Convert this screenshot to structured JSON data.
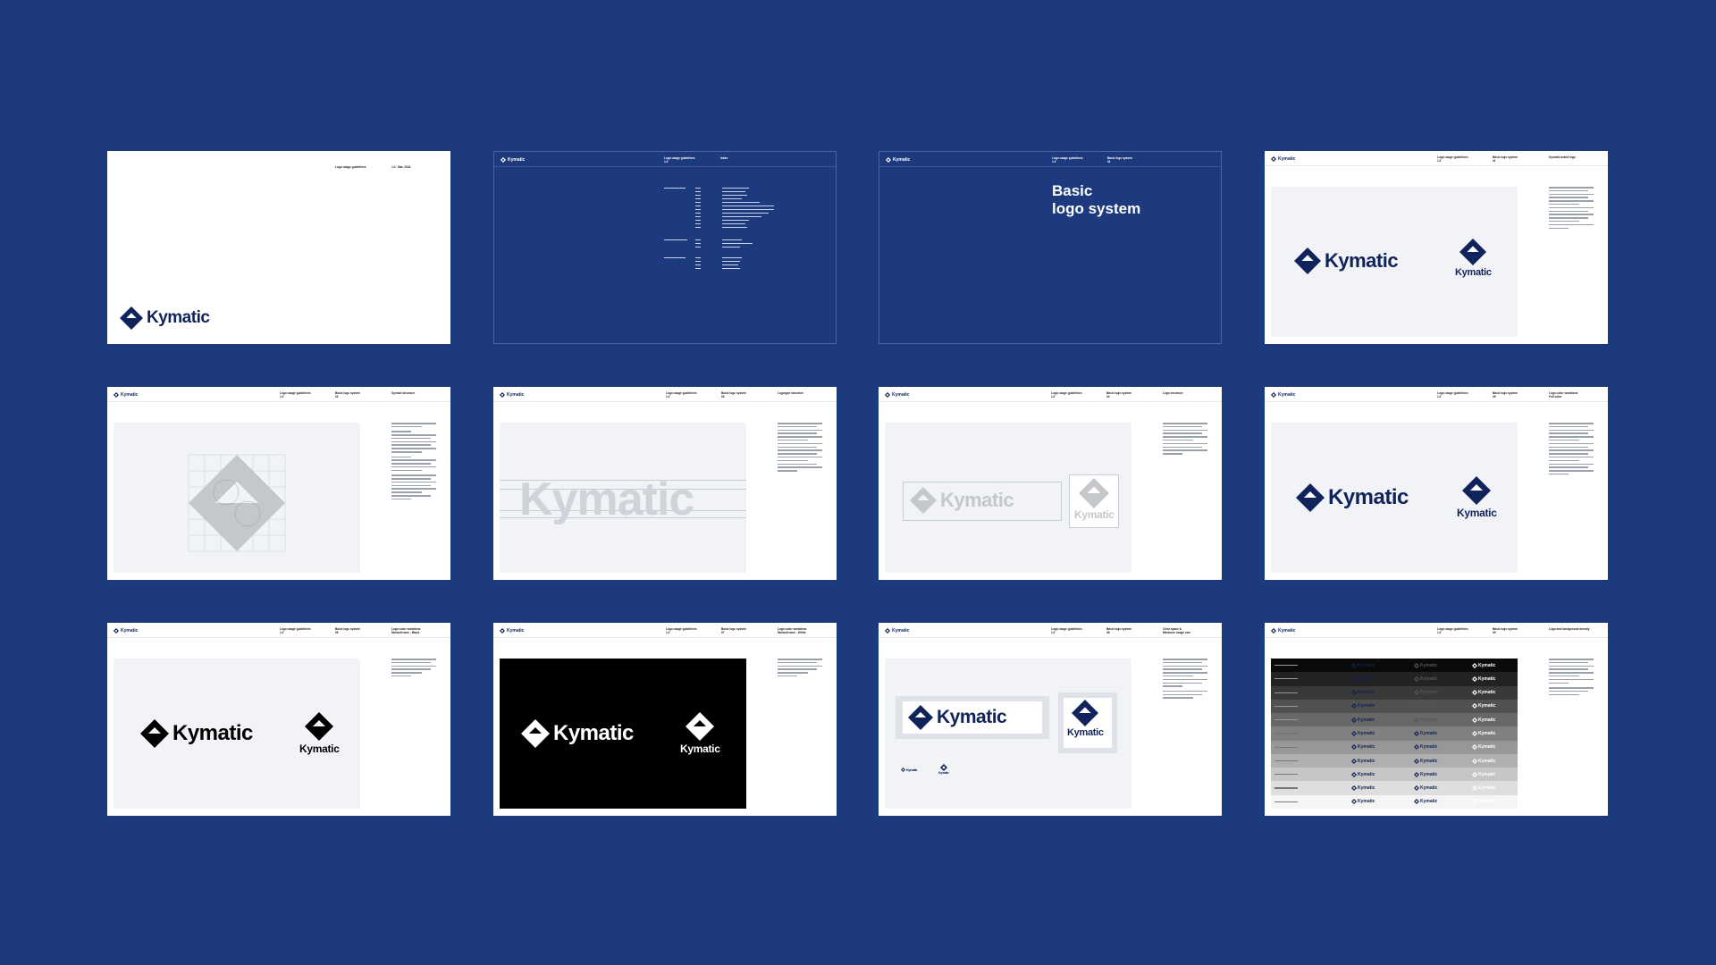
{
  "brand": {
    "name": "Kymatic",
    "navy": "#10235a",
    "blue": "#1c3a7d",
    "background": "#1c3a7d"
  },
  "cover": {
    "title": "Logo usage guidelines",
    "version": "1.0 , Mar. 2024"
  },
  "index": {
    "col1": "Logo usage guidelines\n1.0",
    "col2": "Index"
  },
  "section": {
    "col1": "Logo usage guidelines\n1.0",
    "col2": "Basic logo system\n01",
    "title_line1": "Basic",
    "title_line2": "logo system"
  },
  "slides": {
    "s4": {
      "c1": "Logo usage guidelines\n1.0",
      "c2": "Basic logo system\n01",
      "c3": "Kymatic brand logo"
    },
    "s5": {
      "c1": "Logo usage guidelines\n1.0",
      "c2": "Basic logo system\n02",
      "c3": "Symbol structure"
    },
    "s6": {
      "c1": "Logo usage guidelines\n1.0",
      "c2": "Basic logo system\n03",
      "c3": "Logotype structure"
    },
    "s7": {
      "c1": "Logo usage guidelines\n1.0",
      "c2": "Basic logo system\n04",
      "c3": "Logo structure"
    },
    "s8": {
      "c1": "Logo usage guidelines\n1.0",
      "c2": "Basic logo system\n05",
      "c3": "Logo color variations\nFull color"
    },
    "s9": {
      "c1": "Logo usage guidelines\n1.0",
      "c2": "Basic logo system\n06",
      "c3": "Logo color variations\nMonochrome - Black"
    },
    "s10": {
      "c1": "Logo usage guidelines\n1.0",
      "c2": "Basic logo system\n07",
      "c3": "Logo color variations\nMonochrome - White"
    },
    "s11": {
      "c1": "Logo usage guidelines\n1.0",
      "c2": "Basic logo system\n08",
      "c3": "Clear space &\nMinimum usage size"
    },
    "s12": {
      "c1": "Logo usage guidelines\n1.0",
      "c2": "Basic logo system\n09",
      "c3": "Logo and background density"
    }
  },
  "icons": [
    "kymatic-symbol-icon"
  ]
}
